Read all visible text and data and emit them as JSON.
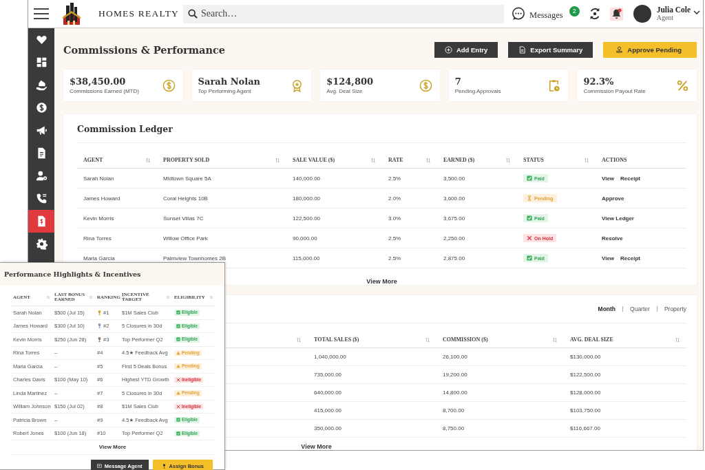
{
  "header": {
    "brand": "HOMES REALTY",
    "search": {
      "placeholder": "Search…"
    },
    "messages_label": "Messages",
    "message_count": "2",
    "notifications_unread": true,
    "user": {
      "name": "Julia Cole",
      "role": "Agent"
    }
  },
  "sidebar": {
    "items": [
      {
        "kind": "heart",
        "selected": false
      },
      {
        "kind": "grid",
        "selected": false
      },
      {
        "kind": "hand-house",
        "selected": false
      },
      {
        "kind": "dollar",
        "selected": false
      },
      {
        "kind": "megaphone",
        "selected": false
      },
      {
        "kind": "document",
        "selected": false
      },
      {
        "kind": "user-gear",
        "selected": false
      },
      {
        "kind": "phone",
        "selected": false
      },
      {
        "kind": "invoice",
        "selected": true
      },
      {
        "kind": "gear",
        "selected": false
      }
    ]
  },
  "page_title": "Commissions & Performance",
  "actions": [
    {
      "label": "Add Entry",
      "kind": "dark"
    },
    {
      "label": "Export Summary",
      "kind": "dark"
    },
    {
      "label": "Approve Pending",
      "kind": "accent"
    }
  ],
  "stats": [
    {
      "value": "$38,450.00",
      "label": "Commissions Earned (MTD)"
    },
    {
      "value": "Sarah Nolan",
      "label": "Top Performing Agent"
    },
    {
      "value": "$124,800",
      "label": "Avg. Deal Size"
    },
    {
      "value": "7",
      "label": "Pending Approvals"
    },
    {
      "value": "92.3%",
      "label": "Commission Payout Rate"
    }
  ],
  "ledger": {
    "title": "Commission Ledger",
    "columns": [
      "AGENT",
      "PROPERTY SOLD",
      "SALE VALUE ($)",
      "RATE",
      "EARNED ($)",
      "STATUS",
      "ACTIONS"
    ],
    "rows": [
      {
        "agent": "Sarah Nolan",
        "property": "Midtown Square 5A",
        "sale": "140,000.00",
        "rate": "2.5%",
        "earned": "3,500.00",
        "status": {
          "label": "Paid",
          "kind": "paid"
        },
        "actions": [
          "View",
          "Receipt"
        ]
      },
      {
        "agent": "James Howard",
        "property": "Coral Heights 10B",
        "sale": "180,000.00",
        "rate": "2.0%",
        "earned": "3,600.00",
        "status": {
          "label": "Pending",
          "kind": "pending"
        },
        "actions": [
          "Approve"
        ]
      },
      {
        "agent": "Kevin Morris",
        "property": "Sunset Villas 7C",
        "sale": "122,500.00",
        "rate": "3.0%",
        "earned": "3,675.00",
        "status": {
          "label": "Paid",
          "kind": "paid"
        },
        "actions": [
          "View Ledger"
        ]
      },
      {
        "agent": "Rina Torres",
        "property": "Willow Office Park",
        "sale": "90,000.00",
        "rate": "2.5%",
        "earned": "2,250.00",
        "status": {
          "label": "On Hold",
          "kind": "on-hold"
        },
        "actions": [
          "Resolve"
        ]
      },
      {
        "agent": "Maria Garcia",
        "property": "Palmview Townhomes 2B",
        "sale": "115,000.00",
        "rate": "2.5%",
        "earned": "2,875.00",
        "status": {
          "label": "Paid",
          "kind": "paid"
        },
        "actions": [
          "View",
          "Receipt"
        ]
      }
    ],
    "view_more": "View More"
  },
  "summary": {
    "tabs": [
      {
        "label": "Month",
        "selected": true
      },
      {
        "label": "Quarter",
        "selected": false
      },
      {
        "label": "Property",
        "selected": false
      }
    ],
    "columns": [
      "TOTAL SALES ($)",
      "COMMISSION ($)",
      "AVG. DEAL SIZE"
    ],
    "rows": [
      [
        "1,040,000.00",
        "26,100.00",
        "$130,000.00"
      ],
      [
        "735,000.00",
        "19,200.00",
        "$122,500.00"
      ],
      [
        "640,000.00",
        "14,800.00",
        "$128,000.00"
      ],
      [
        "415,000.00",
        "8,700.00",
        "$103,750.00"
      ],
      [
        "350,000.00",
        "8,750.00",
        "$116,667.00"
      ]
    ],
    "view_more": "View More"
  },
  "highlights": {
    "title": "Performance Highlights & Incentives",
    "columns": [
      "AGENT",
      "LAST BONUS EARNED",
      "RANKING",
      "INCENTIVE TARGET",
      "ELIGIBILITY"
    ],
    "rows": [
      {
        "agent": "Sarah Nolan",
        "bonus": "$500 (Jul 15)",
        "rank": "#1",
        "color": "#d9a520",
        "target": "$1M Sales Club",
        "eligibility": {
          "label": "Eligible",
          "kind": "eligible"
        }
      },
      {
        "agent": "James Howard",
        "bonus": "$300 (Jul 10)",
        "rank": "#2",
        "color": "#7f9cc6",
        "target": "5 Closures in 30d",
        "eligibility": {
          "label": "Eligible",
          "kind": "eligible"
        }
      },
      {
        "agent": "Kevin Morris",
        "bonus": "$250 (Jun 28)",
        "rank": "#3",
        "color": "#8a7462",
        "target": "Top Performer Q2",
        "eligibility": {
          "label": "Eligible",
          "kind": "eligible"
        }
      },
      {
        "agent": "Rina Torres",
        "bonus": "–",
        "rank": "#4",
        "target": "4.5★ Feedback Avg",
        "eligibility": {
          "label": "Pending",
          "kind": "pending"
        }
      },
      {
        "agent": "Maria Garcia",
        "bonus": "–",
        "rank": "#5",
        "target": "First 5 Deals Bonus",
        "eligibility": {
          "label": "Pending",
          "kind": "pending"
        }
      },
      {
        "agent": "Charles Davis",
        "bonus": "$100 (May 10)",
        "rank": "#6",
        "target": "Highest YTD Growth",
        "eligibility": {
          "label": "Ineligible",
          "kind": "ineligible"
        }
      },
      {
        "agent": "Linda Martinez",
        "bonus": "–",
        "rank": "#7",
        "target": "5 Closures in 30d",
        "eligibility": {
          "label": "Pending",
          "kind": "pending"
        }
      },
      {
        "agent": "William Johnson",
        "bonus": "$150 (Jul 02)",
        "rank": "#8",
        "target": "$1M Sales Club",
        "eligibility": {
          "label": "Ineligible",
          "kind": "ineligible"
        }
      },
      {
        "agent": "Patricia Brown",
        "bonus": "–",
        "rank": "#9",
        "target": "4.5★ Feedback Avg",
        "eligibility": {
          "label": "Eligible",
          "kind": "eligible"
        }
      },
      {
        "agent": "Robert Jones",
        "bonus": "$100 (Jun 18)",
        "rank": "#10",
        "target": "Top Performer Q2",
        "eligibility": {
          "label": "Eligible",
          "kind": "eligible"
        }
      }
    ],
    "view_more": "View More",
    "buttons": [
      {
        "label": "Message Agent",
        "kind": "dark"
      },
      {
        "label": "Assign Bonus",
        "kind": "accent"
      }
    ]
  }
}
